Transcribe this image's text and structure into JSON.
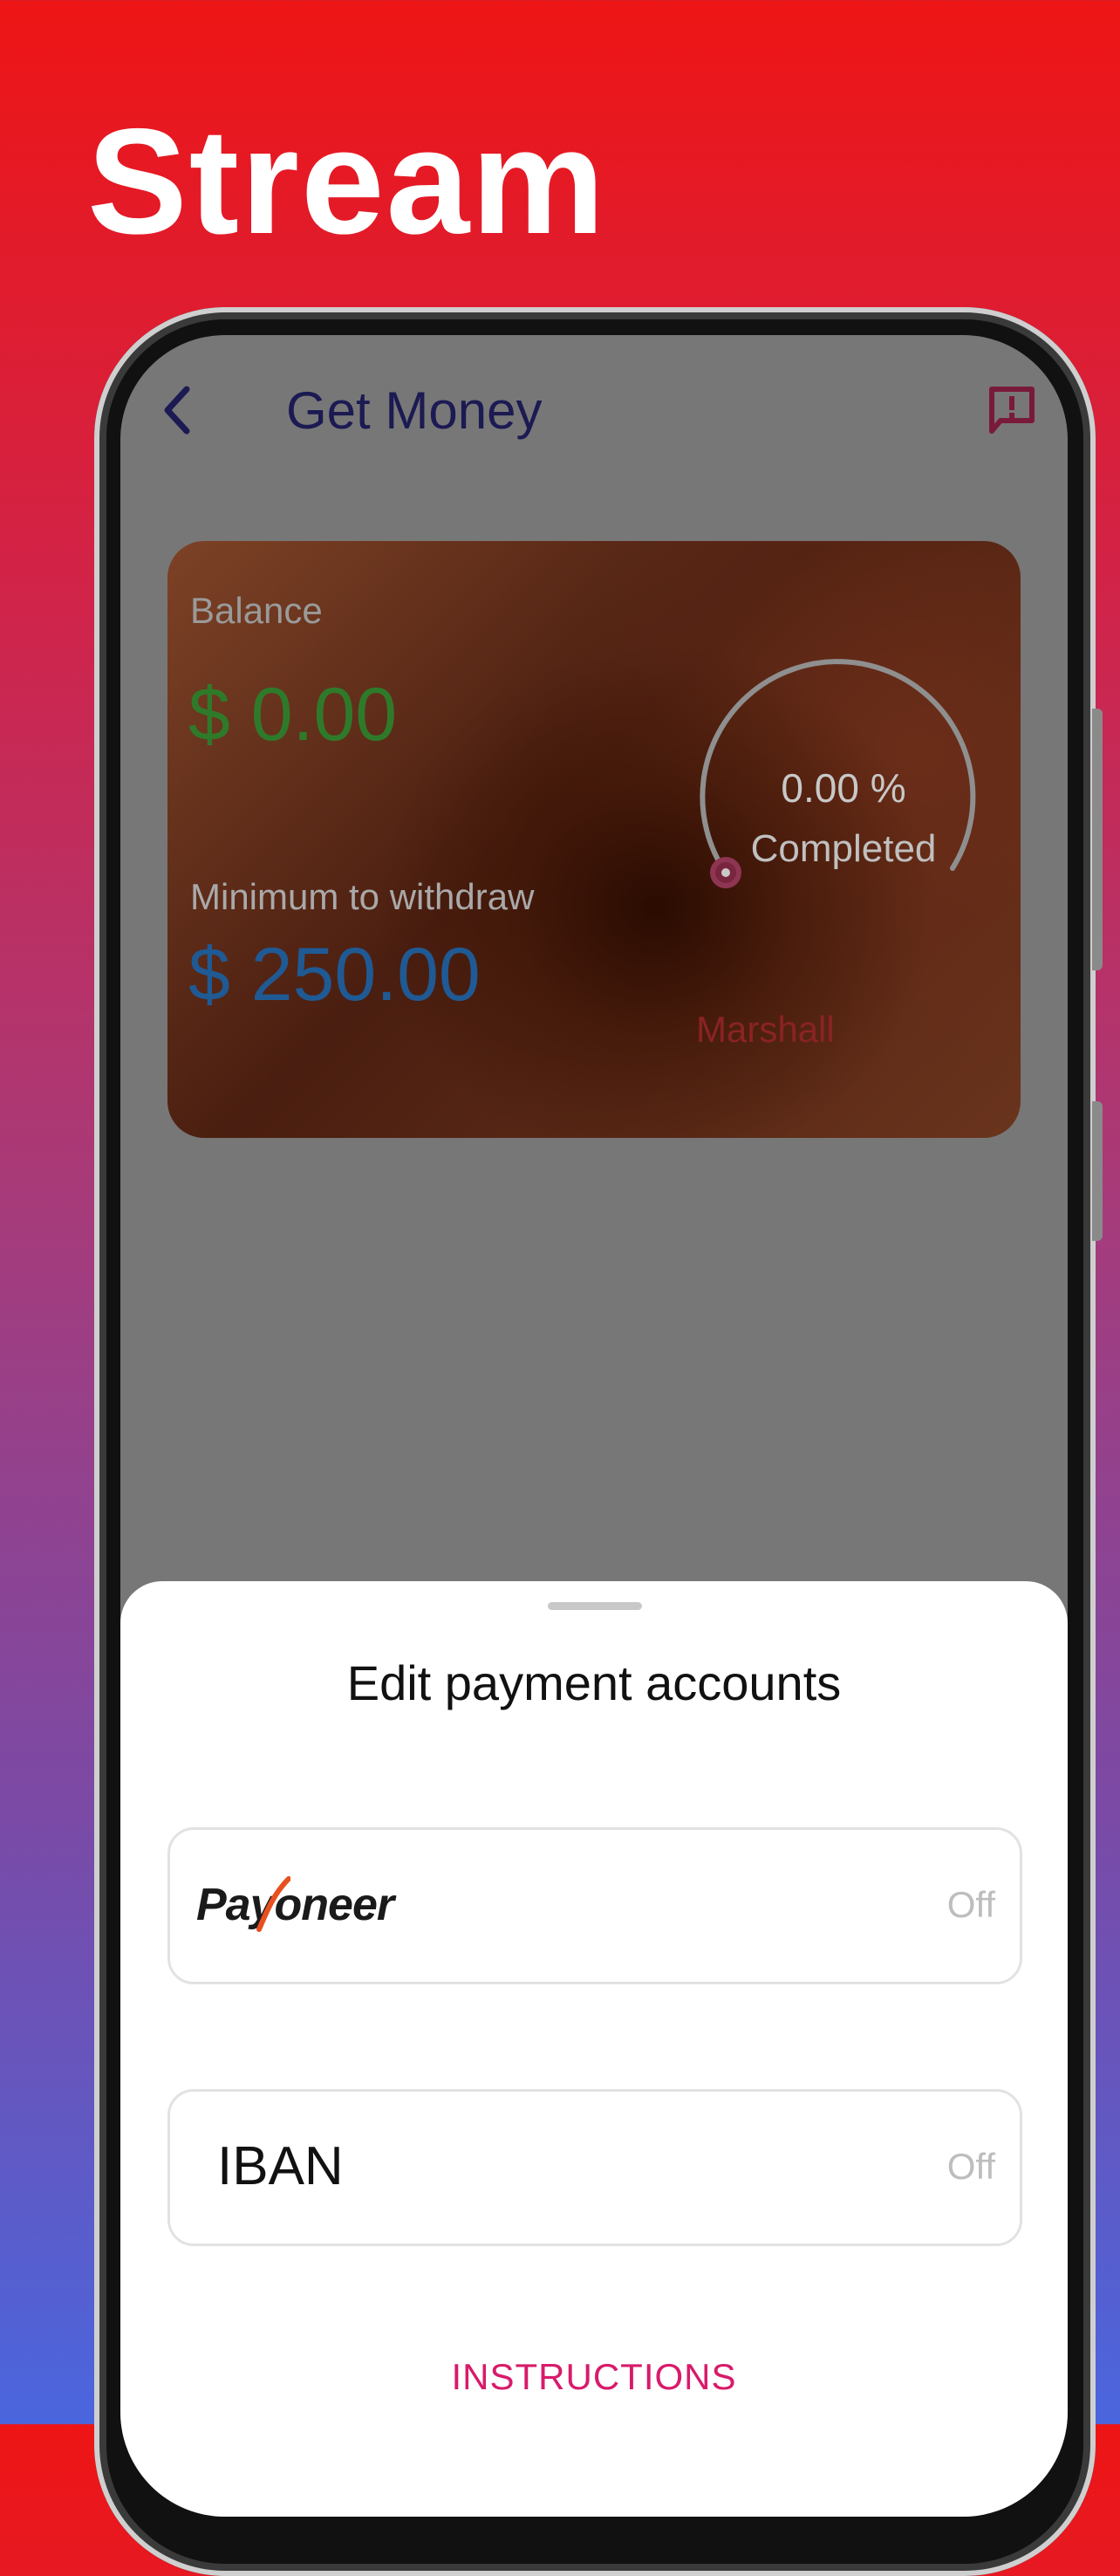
{
  "promo": {
    "title": "Stream"
  },
  "header": {
    "title": "Get Money",
    "back_icon": "chevron-left-icon",
    "report_icon": "report-feedback-icon"
  },
  "balance_card": {
    "balance_label": "Balance",
    "balance_value": "$ 0.00",
    "minimum_label": "Minimum to withdraw",
    "minimum_value": "$ 250.00",
    "progress_text": "0.00 %",
    "progress_fraction": 0.0,
    "progress_caption": "Completed",
    "holder_name": "Marshall"
  },
  "sheet": {
    "title": "Edit payment accounts",
    "accounts": [
      {
        "label": "Payoneer",
        "status": "Off"
      },
      {
        "label": "IBAN",
        "status": "Off"
      }
    ],
    "instructions_label": "INSTRUCTIONS"
  },
  "colors": {
    "header_title": "#1c1a52",
    "balance_value": "#2f7a2a",
    "minimum_value": "#1f5a94",
    "accent": "#d81b6a"
  }
}
